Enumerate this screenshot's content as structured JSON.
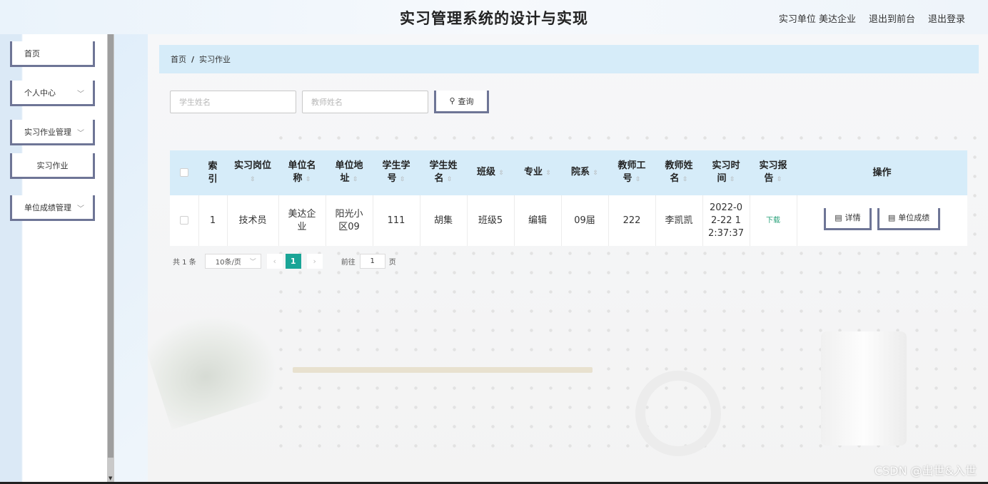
{
  "header": {
    "title": "实习管理系统的设计与实现",
    "user": "实习单位 美达企业",
    "front_link": "退出到前台",
    "logout": "退出登录"
  },
  "sidebar": {
    "items": [
      {
        "label": "首页"
      },
      {
        "label": "个人中心"
      },
      {
        "label": "实习作业管理"
      },
      {
        "label": "实习作业"
      },
      {
        "label": "单位成绩管理"
      }
    ]
  },
  "breadcrumb": {
    "home": "首页",
    "separator": "/",
    "current": "实习作业"
  },
  "search": {
    "student_placeholder": "学生姓名",
    "teacher_placeholder": "教师姓名",
    "button_label": "查询"
  },
  "table": {
    "columns": [
      {
        "line1": "索",
        "line2": "引"
      },
      {
        "line1": "实习岗位",
        "line2": ""
      },
      {
        "line1": "单位名",
        "line2": "称"
      },
      {
        "line1": "单位地",
        "line2": "址"
      },
      {
        "line1": "学生学",
        "line2": "号"
      },
      {
        "line1": "学生姓",
        "line2": "名"
      },
      {
        "line1": "班级",
        "line2": ""
      },
      {
        "line1": "专业",
        "line2": ""
      },
      {
        "line1": "院系",
        "line2": ""
      },
      {
        "line1": "教师工",
        "line2": "号"
      },
      {
        "line1": "教师姓",
        "line2": "名"
      },
      {
        "line1": "实习时",
        "line2": "间"
      },
      {
        "line1": "实习报",
        "line2": "告"
      },
      {
        "line1": "操作",
        "line2": ""
      }
    ],
    "rows": [
      {
        "index": "1",
        "position": "技术员",
        "company_line1": "美达企",
        "company_line2": "业",
        "address_line1": "阳光小",
        "address_line2": "区09",
        "student_no": "111",
        "student_name": "胡集",
        "class": "班级5",
        "major": "编辑",
        "department": "09届",
        "teacher_no": "222",
        "teacher_name": "李凯凯",
        "time_line1": "2022-0",
        "time_line2": "2-22 1",
        "time_line3": "2:37:37",
        "report": "下载",
        "detail_label": "详情",
        "score_label": "单位成绩"
      }
    ]
  },
  "pagination": {
    "total": "共 1 条",
    "page_size": "10条/页",
    "current_page": "1",
    "goto_label": "前往",
    "goto_value": "1",
    "page_suffix": "页"
  },
  "watermark": "CSDN @出世&入世"
}
